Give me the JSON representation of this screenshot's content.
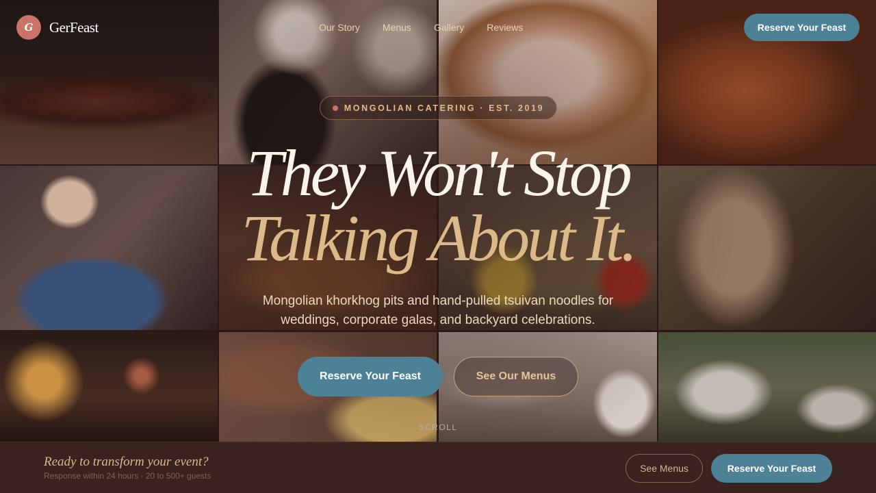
{
  "header": {
    "logo_initial": "G",
    "brand_name": "GerFeast",
    "nav": [
      "Our Story",
      "Menus",
      "Gallery",
      "Reviews"
    ],
    "cta_label": "Reserve Your Feast"
  },
  "hero": {
    "eyebrow": "MONGOLIAN CATERING · EST. 2019",
    "headline_line1": "They Won't Stop",
    "headline_line2": "Talking About It.",
    "subtitle": "Mongolian khorkhog pits and hand-pulled tsuivan noodles for weddings, corporate galas, and backyard celebrations.",
    "primary_cta": "Reserve Your Feast",
    "secondary_cta": "See Our Menus",
    "scroll_label": "SCROLL"
  },
  "bottom_bar": {
    "title": "Ready to transform your event?",
    "subtitle": "Response within 24 hours · 20 to 500+ guests",
    "menus_button": "See Menus",
    "cta_button": "Reserve Your Feast"
  },
  "colors": {
    "accent_teal": "#4d8296",
    "gold": "#dcb989",
    "brand_coral": "#c9736a",
    "dark_brown": "#3a221e"
  }
}
